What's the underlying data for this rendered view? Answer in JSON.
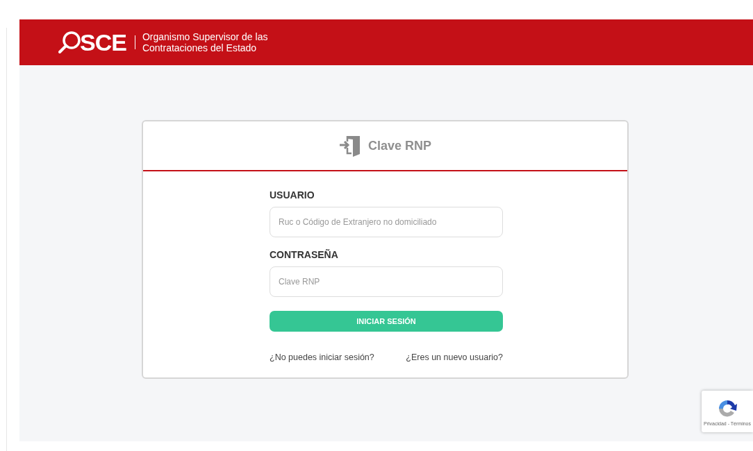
{
  "header": {
    "logo_text": "SCE",
    "org_name_lines": [
      "Organismo Supervisor de las",
      "Contrataciones del Estado"
    ]
  },
  "login_card": {
    "title": "Clave RNP",
    "fields": [
      {
        "label": "USUARIO",
        "placeholder": "Ruc o Código de Extranjero no domiciliado"
      },
      {
        "label": "CONTRASEÑA",
        "placeholder": "Clave RNP"
      }
    ],
    "submit_button": "INICIAR SESIÓN",
    "links": [
      "¿No puedes iniciar sesión?",
      "¿Eres un nuevo usuario?"
    ]
  },
  "recaptcha": {
    "footer": "Privacidad - Términos"
  }
}
